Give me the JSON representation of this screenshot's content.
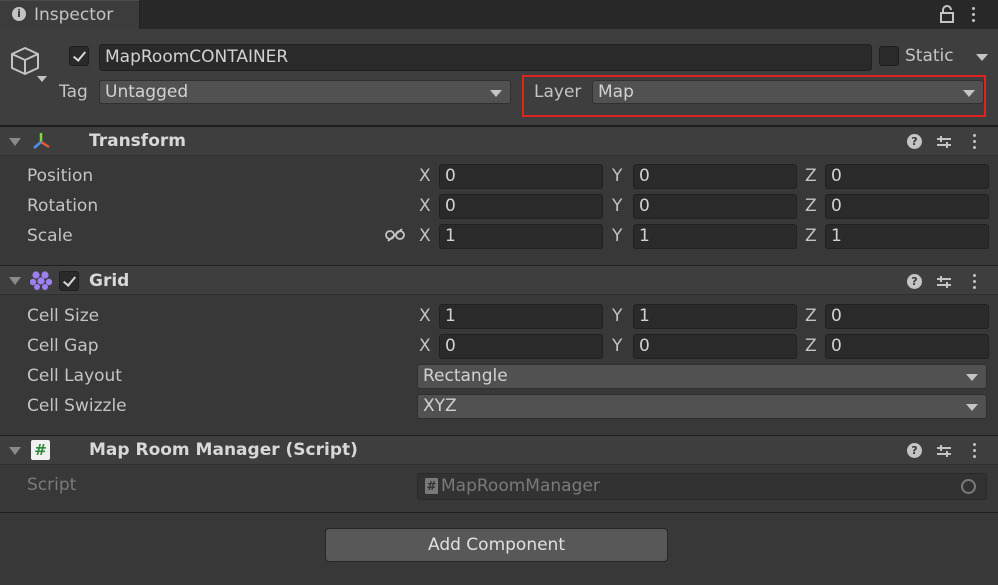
{
  "tab": {
    "title": "Inspector",
    "icon": "info-icon"
  },
  "object": {
    "name": "MapRoomCONTAINER",
    "active": true,
    "static_label": "Static",
    "static_checked": false,
    "tag_label": "Tag",
    "tag_value": "Untagged",
    "layer_label": "Layer",
    "layer_value": "Map"
  },
  "transform": {
    "title": "Transform",
    "rows": [
      {
        "label": "Position",
        "x": "0",
        "y": "0",
        "z": "0"
      },
      {
        "label": "Rotation",
        "x": "0",
        "y": "0",
        "z": "0"
      },
      {
        "label": "Scale",
        "x": "1",
        "y": "1",
        "z": "1"
      }
    ]
  },
  "grid": {
    "title": "Grid",
    "enabled": true,
    "cell_size": {
      "label": "Cell Size",
      "x": "1",
      "y": "1",
      "z": "0"
    },
    "cell_gap": {
      "label": "Cell Gap",
      "x": "0",
      "y": "0",
      "z": "0"
    },
    "cell_layout": {
      "label": "Cell Layout",
      "value": "Rectangle"
    },
    "cell_swizzle": {
      "label": "Cell Swizzle",
      "value": "XYZ"
    }
  },
  "script": {
    "title": "Map Room Manager (Script)",
    "label": "Script",
    "value": "MapRoomManager"
  },
  "axes": {
    "x": "X",
    "y": "Y",
    "z": "Z"
  },
  "add_component": "Add Component",
  "colors": {
    "highlight": "#e0231f",
    "background": "#383838"
  }
}
